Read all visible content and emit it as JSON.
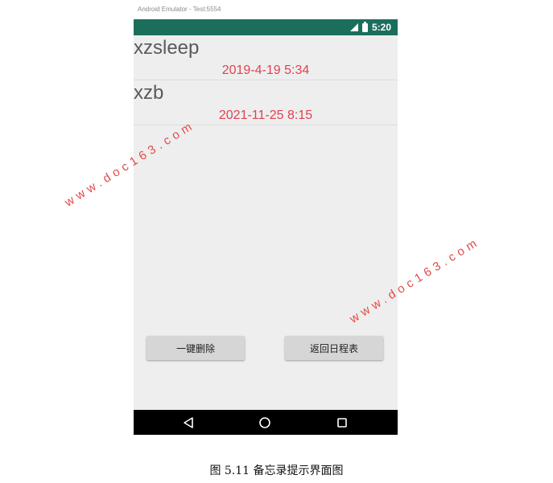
{
  "window": {
    "title": "Android Emulator - Test:5554"
  },
  "status_bar": {
    "time": "5:20",
    "icons": [
      "signal-icon",
      "battery-charging-icon"
    ]
  },
  "memos": [
    {
      "title": "xzsleep",
      "time": "2019-4-19 5:34"
    },
    {
      "title": "xzb",
      "time": "2021-11-25 8:15"
    }
  ],
  "buttons": {
    "delete_all": "一键删除",
    "back_to_schedule": "返回日程表"
  },
  "nav_bar": {
    "icons": [
      "back-icon",
      "home-icon",
      "recent-apps-icon"
    ]
  },
  "caption": "图 5.11 备忘录提示界面图",
  "watermark": "www.doc163.com",
  "colors": {
    "status_bar": "#1b6e5c",
    "memo_time": "#e0424f",
    "watermark": "#e34a4a"
  }
}
